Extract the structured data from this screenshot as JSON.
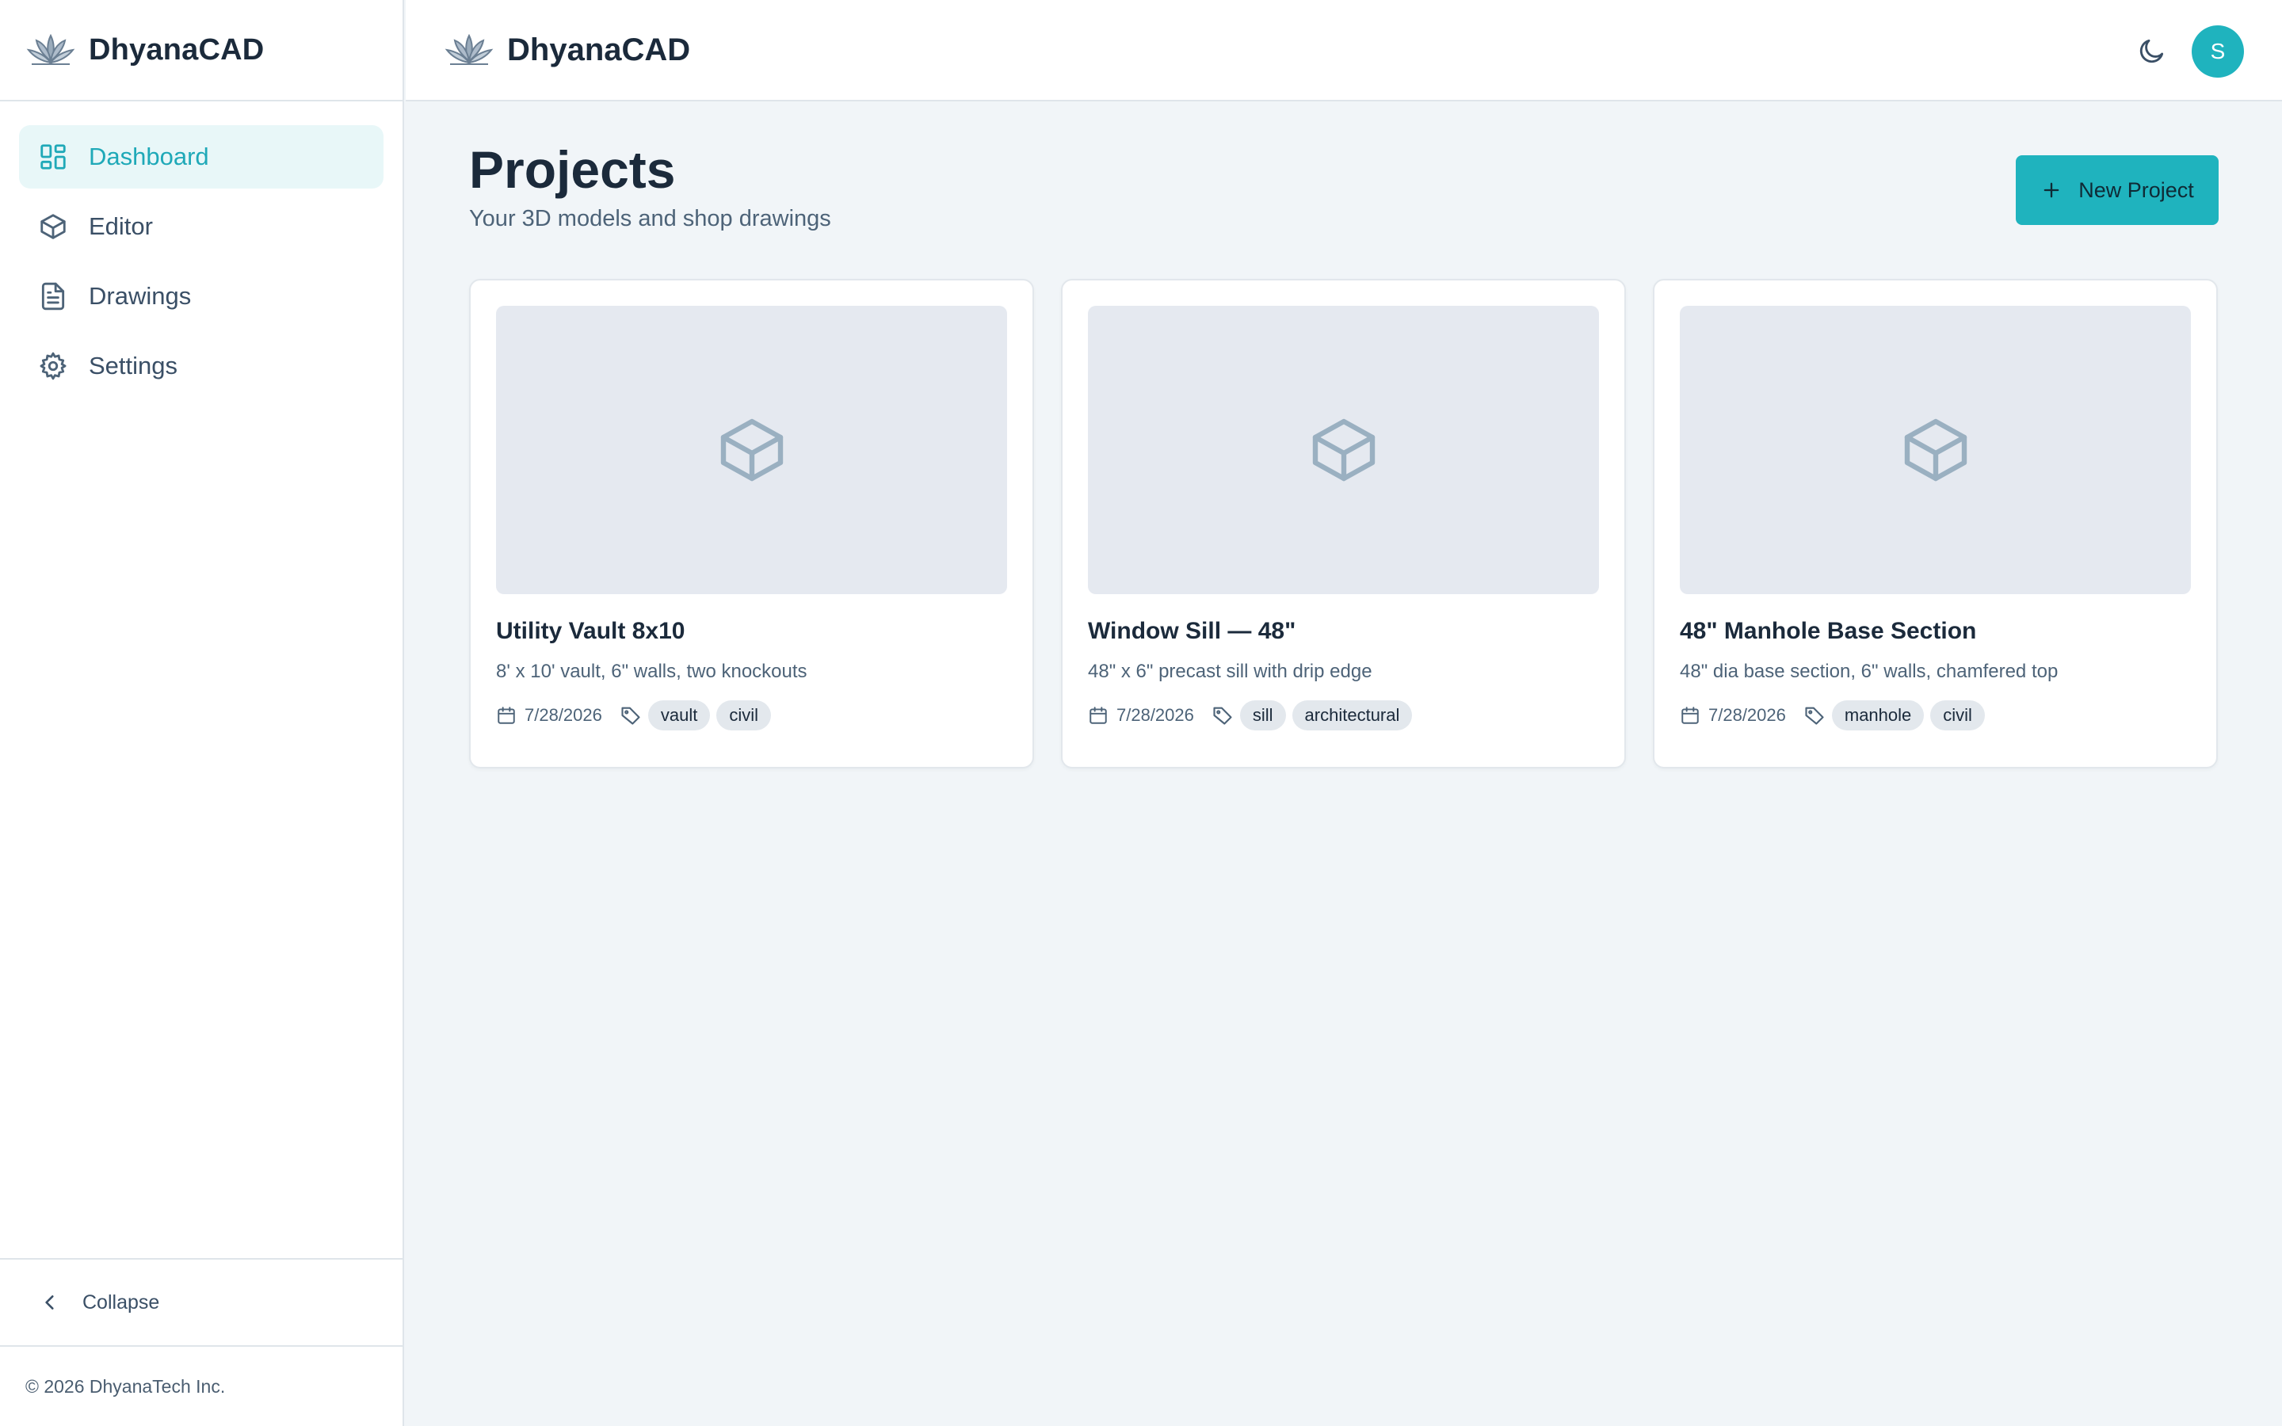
{
  "app": {
    "name": "DhyanaCAD"
  },
  "sidebar": {
    "brand": "DhyanaCAD",
    "items": [
      {
        "label": "Dashboard",
        "icon": "dashboard-icon",
        "active": true
      },
      {
        "label": "Editor",
        "icon": "cube-icon",
        "active": false
      },
      {
        "label": "Drawings",
        "icon": "file-text-icon",
        "active": false
      },
      {
        "label": "Settings",
        "icon": "gear-icon",
        "active": false
      }
    ],
    "collapse_label": "Collapse",
    "copyright": "© 2026 DhyanaTech Inc."
  },
  "topbar": {
    "brand": "DhyanaCAD",
    "avatar_initial": "S",
    "theme_icon": "moon-icon"
  },
  "page": {
    "title": "Projects",
    "subtitle": "Your 3D models and shop drawings",
    "new_button_label": "New Project"
  },
  "projects": [
    {
      "title": "Utility Vault 8x10",
      "description": "8' x 10' vault, 6\" walls, two knockouts",
      "date": "7/28/2026",
      "tags": [
        "vault",
        "civil"
      ]
    },
    {
      "title": "Window Sill — 48\"",
      "description": "48\" x 6\" precast sill with drip edge",
      "date": "7/28/2026",
      "tags": [
        "sill",
        "architectural"
      ]
    },
    {
      "title": "48\" Manhole Base Section",
      "description": "48\" dia base section, 6\" walls, chamfered top",
      "date": "7/28/2026",
      "tags": [
        "manhole",
        "civil"
      ]
    }
  ],
  "colors": {
    "accent": "#1fb3be",
    "active_nav_bg": "#e8f7f8",
    "active_nav_text": "#1fa9b8",
    "page_bg": "#f1f5f8",
    "thumb_bg": "#e5e9f0"
  }
}
